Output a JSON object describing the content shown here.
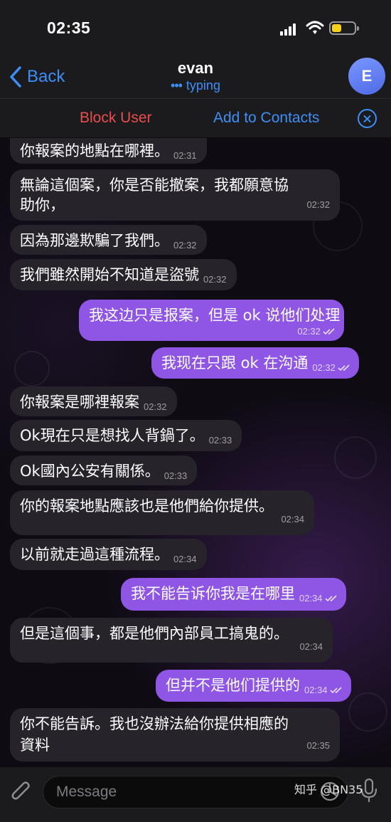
{
  "status_bar": {
    "time": "02:35"
  },
  "header": {
    "back_label": "Back",
    "title": "evan",
    "subtitle": "typing",
    "avatar_letter": "E"
  },
  "action_bar": {
    "block_label": "Block User",
    "add_label": "Add to Contacts"
  },
  "messages": [
    {
      "dir": "in",
      "text": "你報案的地點在哪裡。",
      "time": "02:31"
    },
    {
      "dir": "in",
      "text": "無論這個案，你是否能撤案，我都願意協",
      "text2": "助你，",
      "time": "02:32"
    },
    {
      "dir": "in",
      "text": "因為那邊欺騙了我們。",
      "time": "02:32"
    },
    {
      "dir": "in",
      "text": "我們雖然開始不知道是盜號",
      "time": "02:32"
    },
    {
      "dir": "out",
      "text": "我这边只是报案，但是 ok 说他们处理",
      "time": "02:32"
    },
    {
      "dir": "out",
      "text": "我现在只跟 ok 在沟通",
      "time": "02:32"
    },
    {
      "dir": "in",
      "text": "你報案是哪裡報案",
      "time": "02:32"
    },
    {
      "dir": "in",
      "text": "Ok現在只是想找人背鍋了。",
      "time": "02:33"
    },
    {
      "dir": "in",
      "text": "Ok國內公安有關係。",
      "time": "02:33"
    },
    {
      "dir": "in",
      "text": "你的報案地點應該也是他們給你提供。",
      "time": "02:34"
    },
    {
      "dir": "in",
      "text": "以前就走過這種流程。",
      "time": "02:34"
    },
    {
      "dir": "out",
      "text": "我不能告诉你我是在哪里",
      "time": "02:34"
    },
    {
      "dir": "in",
      "text": "但是這個事，都是他們內部員工搞鬼的。",
      "time": "02:34"
    },
    {
      "dir": "out",
      "text": "但并不是他们提供的",
      "time": "02:34"
    },
    {
      "dir": "in",
      "text": "你不能告訴。我也沒辦法給你提供相應的",
      "text2": "資料",
      "time": "02:35"
    }
  ],
  "composer": {
    "placeholder": "Message"
  },
  "watermark": "知乎 @BN35",
  "colors": {
    "accent": "#3e8ef7",
    "danger": "#eb4d4d",
    "outgoing_bubble": "#8f56e6",
    "incoming_bubble": "#26232b"
  },
  "icons": [
    "back-chevron-icon",
    "signal-icon",
    "wifi-icon",
    "battery-icon",
    "close-icon",
    "read-check-icon",
    "attach-icon",
    "sticker-icon",
    "mic-icon"
  ]
}
